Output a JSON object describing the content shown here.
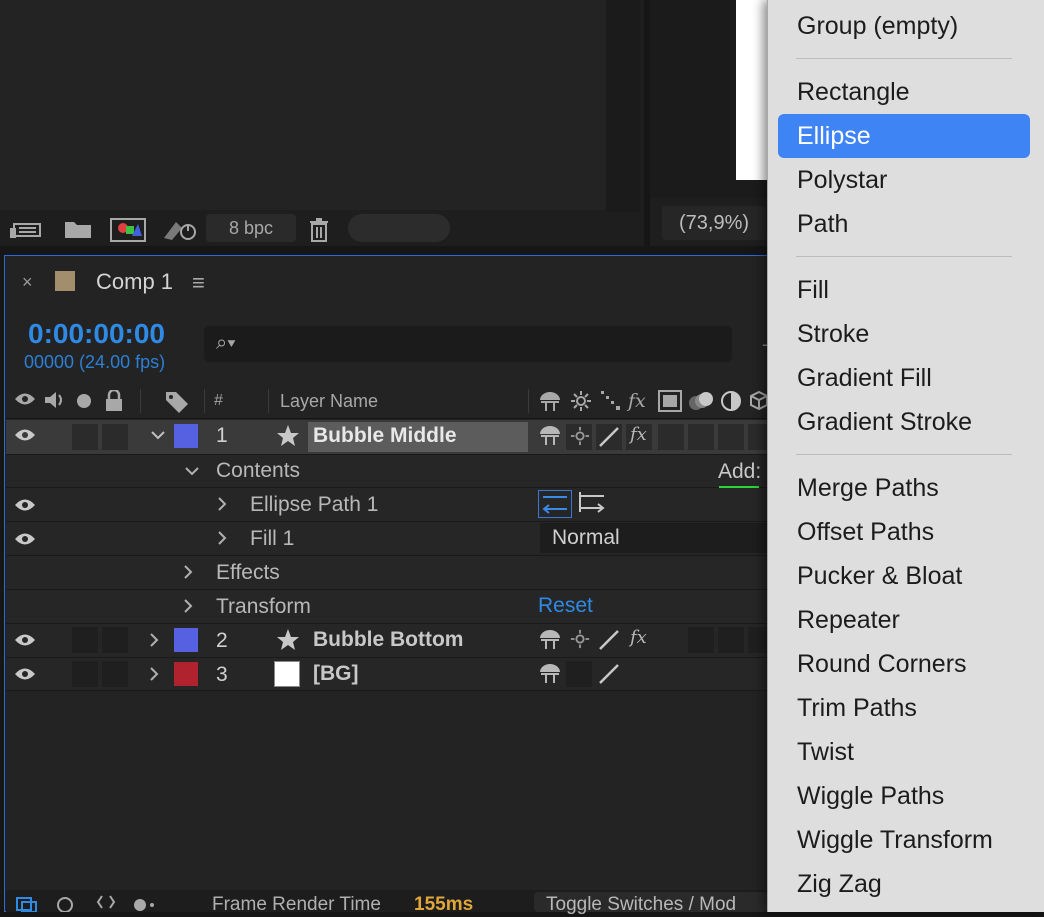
{
  "project_panel": {
    "bpc_label": "8 bpc",
    "icons": [
      "interpret-footage-icon",
      "folder-icon",
      "new-comp-icon",
      "render-icon",
      "trash-icon"
    ]
  },
  "viewer": {
    "zoom": "(73,9%)"
  },
  "comp_tab": {
    "close": "×",
    "label": "Comp 1",
    "menu": "≡",
    "swatch_color": "#a28e6c"
  },
  "timeline": {
    "timecode": "0:00:00:00",
    "frames": "00000 (24.00 fps)",
    "search_icon": "⌕▾",
    "header": {
      "num": "#",
      "layer_name": "Layer Name"
    },
    "add_label": "Add:",
    "reset_label": "Reset",
    "blend_mode": "Normal",
    "layers": [
      {
        "num": "1",
        "name": "Bubble Middle",
        "color": "#5561e0",
        "type": "shape"
      },
      {
        "num": "2",
        "name": "Bubble Bottom",
        "color": "#5561e0",
        "type": "shape"
      },
      {
        "num": "3",
        "name": "[BG]",
        "color": "#b0222e",
        "type": "solid"
      }
    ],
    "props": {
      "contents": "Contents",
      "ellipse_path": "Ellipse Path 1",
      "fill": "Fill 1",
      "effects": "Effects",
      "transform": "Transform"
    },
    "footer": {
      "frame_render_label": "Frame Render Time",
      "frame_render_value": "155ms",
      "toggle": "Toggle Switches / Mod"
    }
  },
  "menu": {
    "items": [
      "Group (empty)",
      "Rectangle",
      "Ellipse",
      "Polystar",
      "Path",
      "Fill",
      "Stroke",
      "Gradient Fill",
      "Gradient Stroke",
      "Merge Paths",
      "Offset Paths",
      "Pucker & Bloat",
      "Repeater",
      "Round Corners",
      "Trim Paths",
      "Twist",
      "Wiggle Paths",
      "Wiggle Transform",
      "Zig Zag"
    ],
    "selected": "Ellipse",
    "highlight_color": "#3f84f4"
  }
}
